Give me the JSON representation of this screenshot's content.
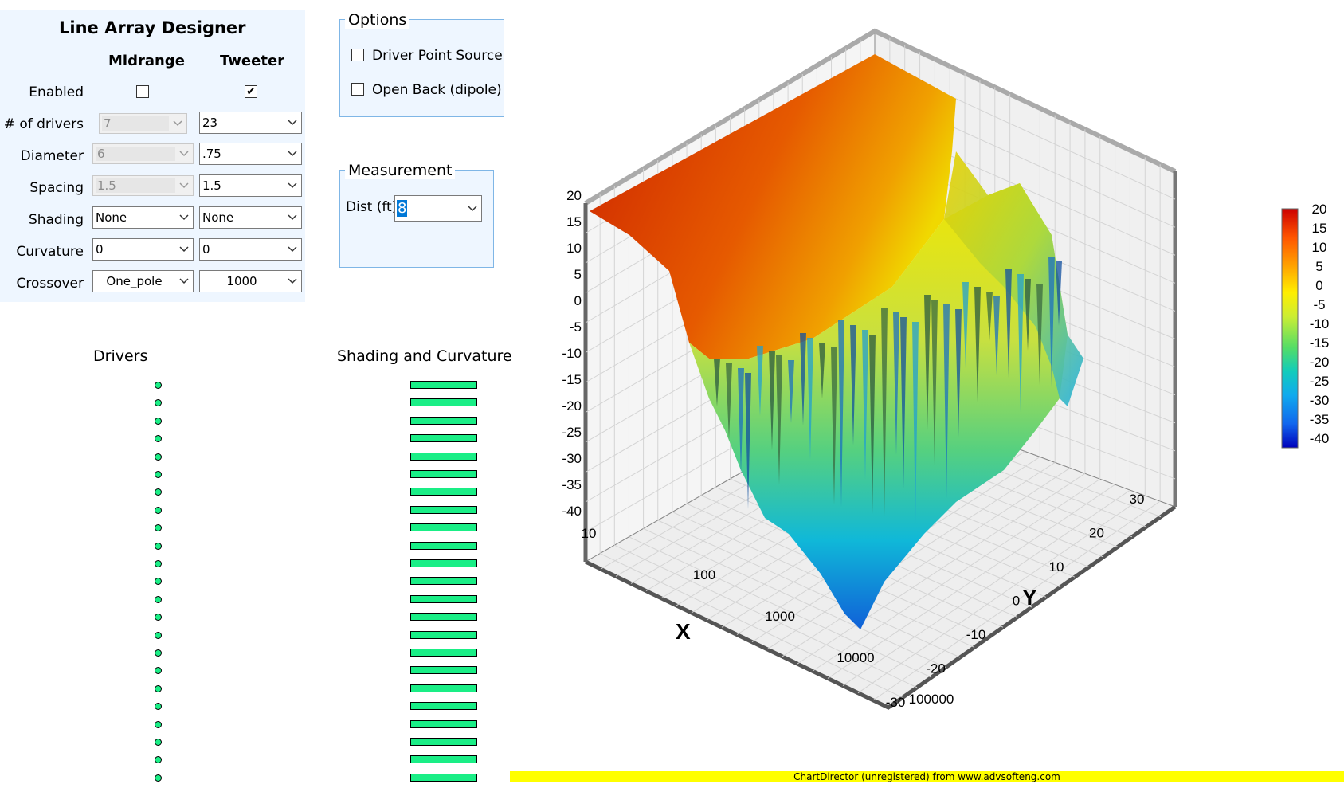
{
  "designer": {
    "title": "Line Array Designer",
    "col_midrange": "Midrange",
    "col_tweeter": "Tweeter",
    "rows": {
      "enabled": {
        "label": "Enabled",
        "midrange_checked": false,
        "tweeter_checked": true,
        "tweeter_mark": "✔"
      },
      "drivers": {
        "label": "# of drivers",
        "midrange": "7",
        "tweeter": "23"
      },
      "diameter": {
        "label": "Diameter",
        "midrange": "6",
        "tweeter": ".75"
      },
      "spacing": {
        "label": "Spacing",
        "midrange": "1.5",
        "tweeter": "1.5"
      },
      "shading": {
        "label": "Shading",
        "midrange": "None",
        "tweeter": "None"
      },
      "curvature": {
        "label": "Curvature",
        "midrange": "0",
        "tweeter": "0"
      },
      "crossover": {
        "label": "Crossover",
        "midrange": "One_pole",
        "tweeter": "1000"
      }
    }
  },
  "options": {
    "title": "Options",
    "driver_point_source": {
      "label": "Driver Point Source",
      "checked": false
    },
    "open_back": {
      "label": "Open Back (dipole)",
      "checked": false
    }
  },
  "measurement": {
    "title": "Measurement",
    "dist_label": "Dist (ft)",
    "dist_value": "8"
  },
  "drivers_panel": {
    "title": "Drivers",
    "count": 23
  },
  "shading_panel": {
    "title": "Shading and Curvature"
  },
  "chart_data": {
    "type": "surface3d",
    "x_label": "X",
    "y_label": "Y",
    "x_scale": "log",
    "x_ticks": [
      "10",
      "100",
      "1000",
      "10000",
      "100000"
    ],
    "y_ticks": [
      "-30",
      "-20",
      "-10",
      "0",
      "10",
      "20",
      "30"
    ],
    "z_ticks": [
      "20",
      "15",
      "10",
      "5",
      "0",
      "-5",
      "-10",
      "-15",
      "-20",
      "-25",
      "-30",
      "-35",
      "-40"
    ],
    "zlim": [
      -40,
      20
    ],
    "colorbar_ticks": [
      "20",
      "15",
      "10",
      "5",
      "0",
      "-5",
      "-10",
      "-15",
      "-20",
      "-25",
      "-30",
      "-35",
      "-40"
    ],
    "colormap": [
      "#cc0000",
      "#ff5500",
      "#ffaa00",
      "#ffee00",
      "#ccee33",
      "#55dd66",
      "#11ccbb",
      "#11aaee",
      "#1166ee",
      "#0000bb"
    ],
    "grid": true
  },
  "footer": {
    "banner": "ChartDirector (unregistered) from www.advsofteng.com"
  }
}
